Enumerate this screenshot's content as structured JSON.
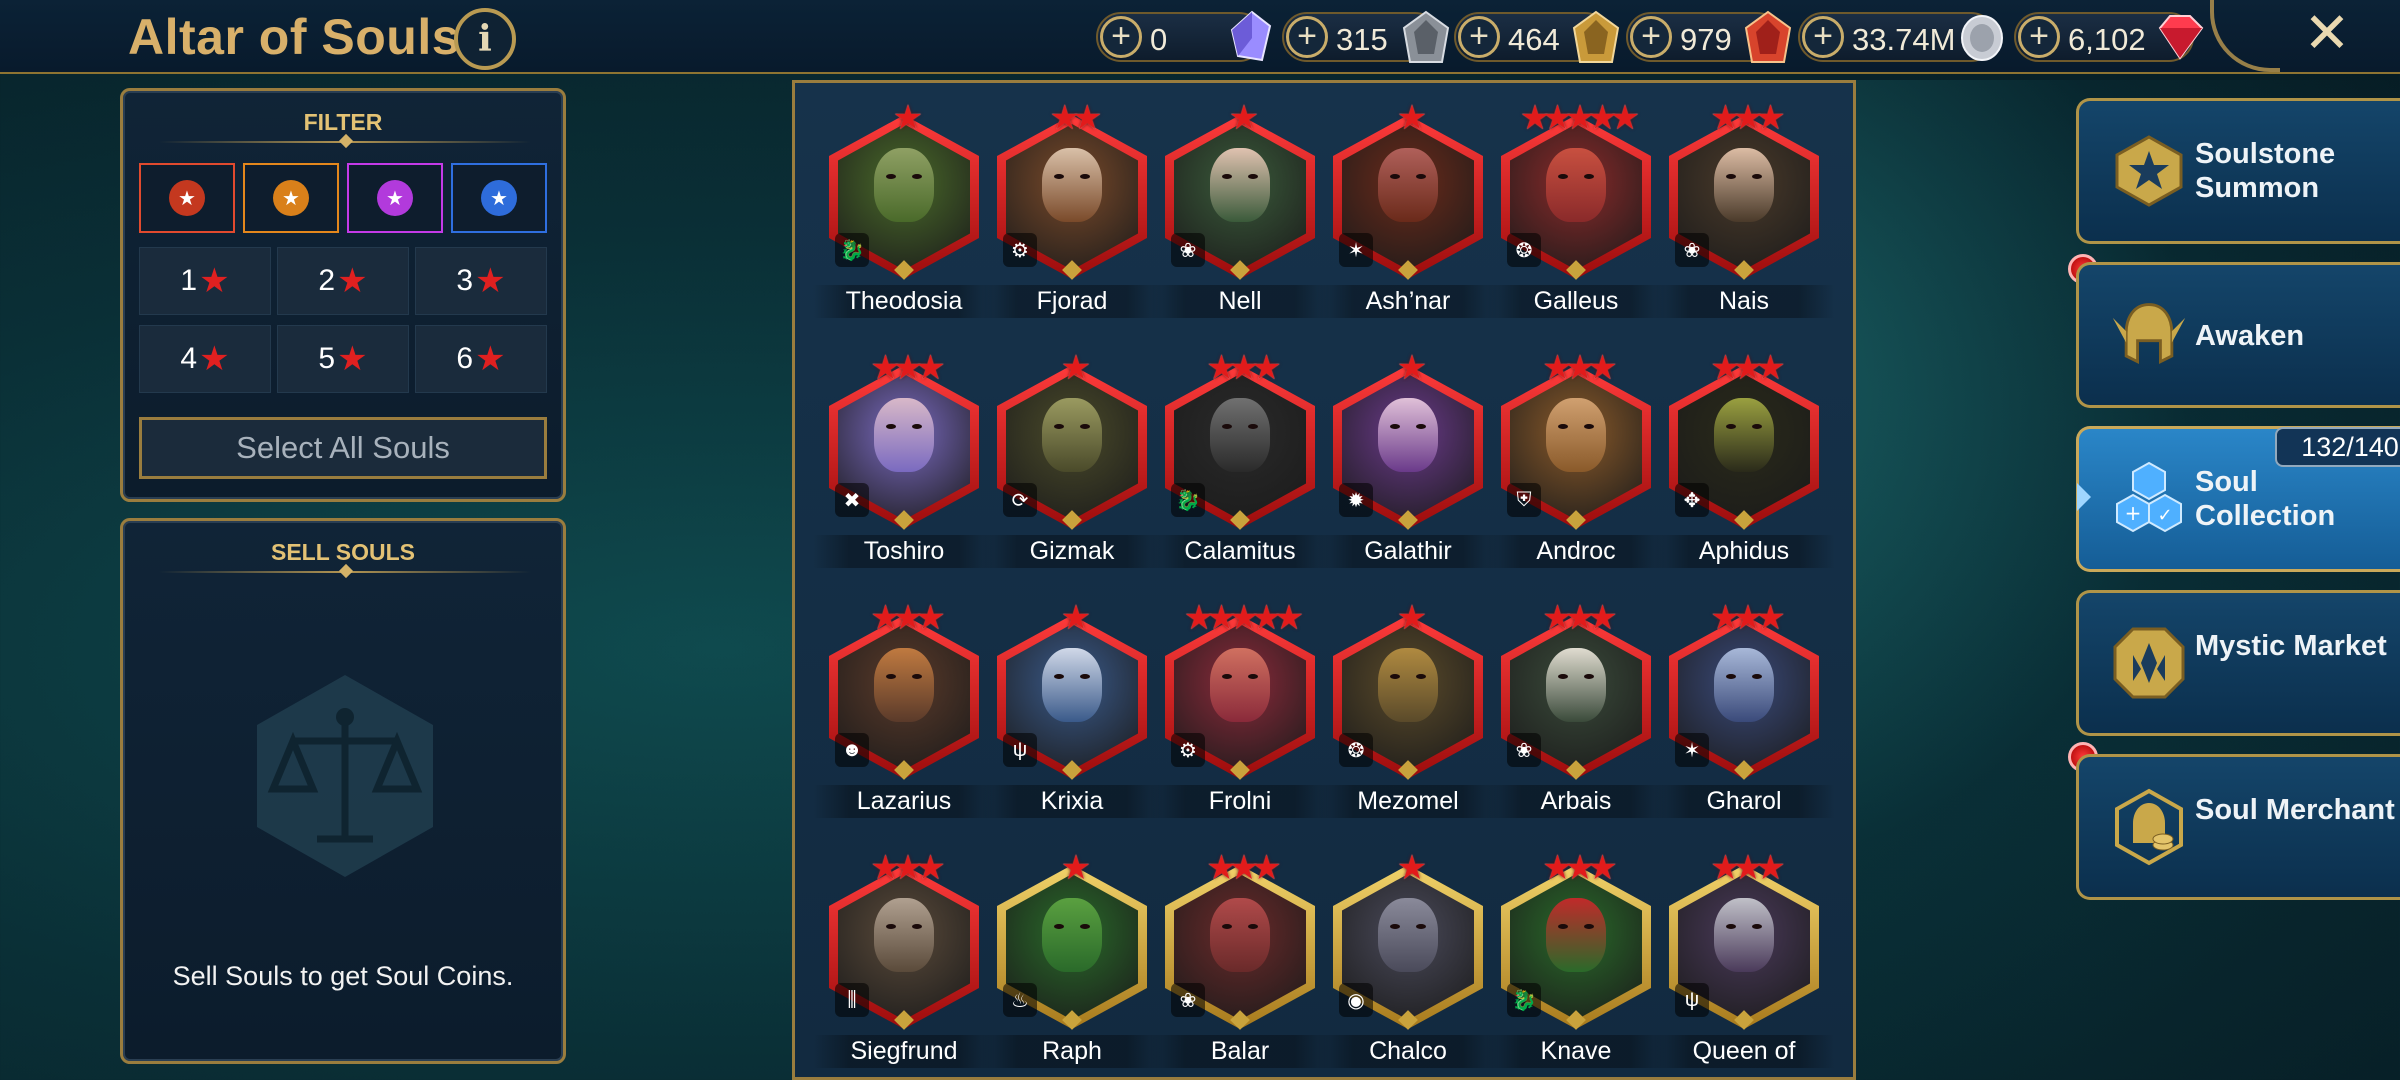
{
  "header": {
    "title": "Altar of Souls",
    "info_label": "i",
    "close_label": "✕"
  },
  "resources": [
    {
      "name": "soulstone",
      "value": "0",
      "color": "#9a8cff"
    },
    {
      "name": "mystery-shard",
      "value": "315",
      "color": "#9aa0a8"
    },
    {
      "name": "ancient-shard",
      "value": "464",
      "color": "#c99a3a"
    },
    {
      "name": "sacred-shard",
      "value": "979",
      "color": "#d8442c"
    },
    {
      "name": "silver",
      "value": "33.74M",
      "color": "#c8ccd4"
    },
    {
      "name": "gems",
      "value": "6,102",
      "color": "#ff3b4e"
    }
  ],
  "filter": {
    "heading": "FILTER",
    "factions": [
      {
        "name": "red",
        "color": "#e14a2e",
        "medal": "#c4381f"
      },
      {
        "name": "orange",
        "color": "#e3871c",
        "medal": "#d9801a"
      },
      {
        "name": "purple",
        "color": "#c43ae8",
        "medal": "#b23adc"
      },
      {
        "name": "blue",
        "color": "#2f6fe0",
        "medal": "#2e6cdb"
      }
    ],
    "stars": [
      {
        "n": "1",
        "star": "★"
      },
      {
        "n": "2",
        "star": "★"
      },
      {
        "n": "3",
        "star": "★"
      },
      {
        "n": "4",
        "star": "★"
      },
      {
        "n": "5",
        "star": "★"
      },
      {
        "n": "6",
        "star": "★"
      }
    ],
    "select_all": "Select All Souls"
  },
  "sell": {
    "heading": "SELL SOULS",
    "text": "Sell Souls to get Soul Coins."
  },
  "champions": [
    {
      "name": "Theodosia",
      "stars": "★",
      "frame": "red",
      "bg": "#4a6a2a",
      "skin": "#8fa064",
      "badge": "🐉"
    },
    {
      "name": "Fjorad",
      "stars": "★★",
      "frame": "red",
      "bg": "#7a4a2a",
      "skin": "#d9c0a8",
      "badge": "⚙"
    },
    {
      "name": "Nell",
      "stars": "★",
      "frame": "red",
      "bg": "#3a5a3a",
      "skin": "#e0c2b0",
      "badge": "❀"
    },
    {
      "name": "Ash’nar",
      "stars": "★",
      "frame": "red",
      "bg": "#6a2a1a",
      "skin": "#b0605a",
      "badge": "✶"
    },
    {
      "name": "Galleus",
      "stars": "★★★★★",
      "frame": "red",
      "bg": "#8a2a2a",
      "skin": "#c85040",
      "badge": "❂"
    },
    {
      "name": "Nais",
      "stars": "★★★",
      "frame": "red",
      "bg": "#4a3a2a",
      "skin": "#dcbca4",
      "badge": "❀"
    },
    {
      "name": "Toshiro",
      "stars": "★★★",
      "frame": "red",
      "bg": "#7a6ac0",
      "skin": "#d8b8c8",
      "badge": "✖"
    },
    {
      "name": "Gizmak",
      "stars": "★",
      "frame": "red",
      "bg": "#4a4a2a",
      "skin": "#9a9a60",
      "badge": "⟳"
    },
    {
      "name": "Calamitus",
      "stars": "★★★",
      "frame": "red",
      "bg": "#2a2a2a",
      "skin": "#707070",
      "badge": "🐉"
    },
    {
      "name": "Galathir",
      "stars": "★",
      "frame": "red",
      "bg": "#6a3a8a",
      "skin": "#e0c0d8",
      "badge": "✹"
    },
    {
      "name": "Androc",
      "stars": "★★★",
      "frame": "red",
      "bg": "#8a5a2a",
      "skin": "#d0a070",
      "badge": "⛨"
    },
    {
      "name": "Aphidus",
      "stars": "★★★",
      "frame": "red",
      "bg": "#2a2a1a",
      "skin": "#9aa040",
      "badge": "✥"
    },
    {
      "name": "Lazarius",
      "stars": "★★★",
      "frame": "red",
      "bg": "#5a3a2a",
      "skin": "#c07a40",
      "badge": "☻"
    },
    {
      "name": "Krixia",
      "stars": "★",
      "frame": "red",
      "bg": "#3a5a8a",
      "skin": "#d0d8e8",
      "badge": "ψ"
    },
    {
      "name": "Frolni",
      "stars": "★★★★★",
      "frame": "red",
      "bg": "#8a2a3a",
      "skin": "#d07060",
      "badge": "⚙"
    },
    {
      "name": "Mezomel",
      "stars": "★",
      "frame": "red",
      "bg": "#5a4a2a",
      "skin": "#b08a40",
      "badge": "❂"
    },
    {
      "name": "Arbais",
      "stars": "★★★",
      "frame": "red",
      "bg": "#3a4a3a",
      "skin": "#e0dcd0",
      "badge": "❀"
    },
    {
      "name": "Gharol",
      "stars": "★★★",
      "frame": "red",
      "bg": "#3a4a7a",
      "skin": "#a8b8d8",
      "badge": "✶"
    },
    {
      "name": "Siegfrund",
      "stars": "★★★",
      "frame": "red",
      "bg": "#5a4a3a",
      "skin": "#b0a090",
      "badge": "⫼"
    },
    {
      "name": "Raph",
      "stars": "★",
      "frame": "gold",
      "bg": "#2a6a2a",
      "skin": "#5aa040",
      "badge": "♨"
    },
    {
      "name": "Balar",
      "stars": "★★★",
      "frame": "gold",
      "bg": "#6a2a2a",
      "skin": "#b04a4a",
      "badge": "❀"
    },
    {
      "name": "Chalco",
      "stars": "★",
      "frame": "gold",
      "bg": "#4a4a5a",
      "skin": "#8a8a9a",
      "badge": "◉"
    },
    {
      "name": "Knave",
      "stars": "★★★",
      "frame": "gold",
      "bg": "#2a6a2a",
      "skin": "#c02a2a",
      "badge": "🐉"
    },
    {
      "name": "Queen of",
      "stars": "★★★",
      "frame": "gold",
      "bg": "#4a3a5a",
      "skin": "#c0c0c8",
      "badge": "ψ"
    }
  ],
  "nav": [
    {
      "label": "Soulstone Summon",
      "icon": "soulstone-icon"
    },
    {
      "label": "Awaken",
      "icon": "helmet-icon"
    },
    {
      "label": "Soul Collection",
      "icon": "collection-icon",
      "count": "132/140"
    },
    {
      "label": "Mystic Market",
      "icon": "market-icon"
    },
    {
      "label": "Soul Merchant",
      "icon": "merchant-icon"
    }
  ]
}
